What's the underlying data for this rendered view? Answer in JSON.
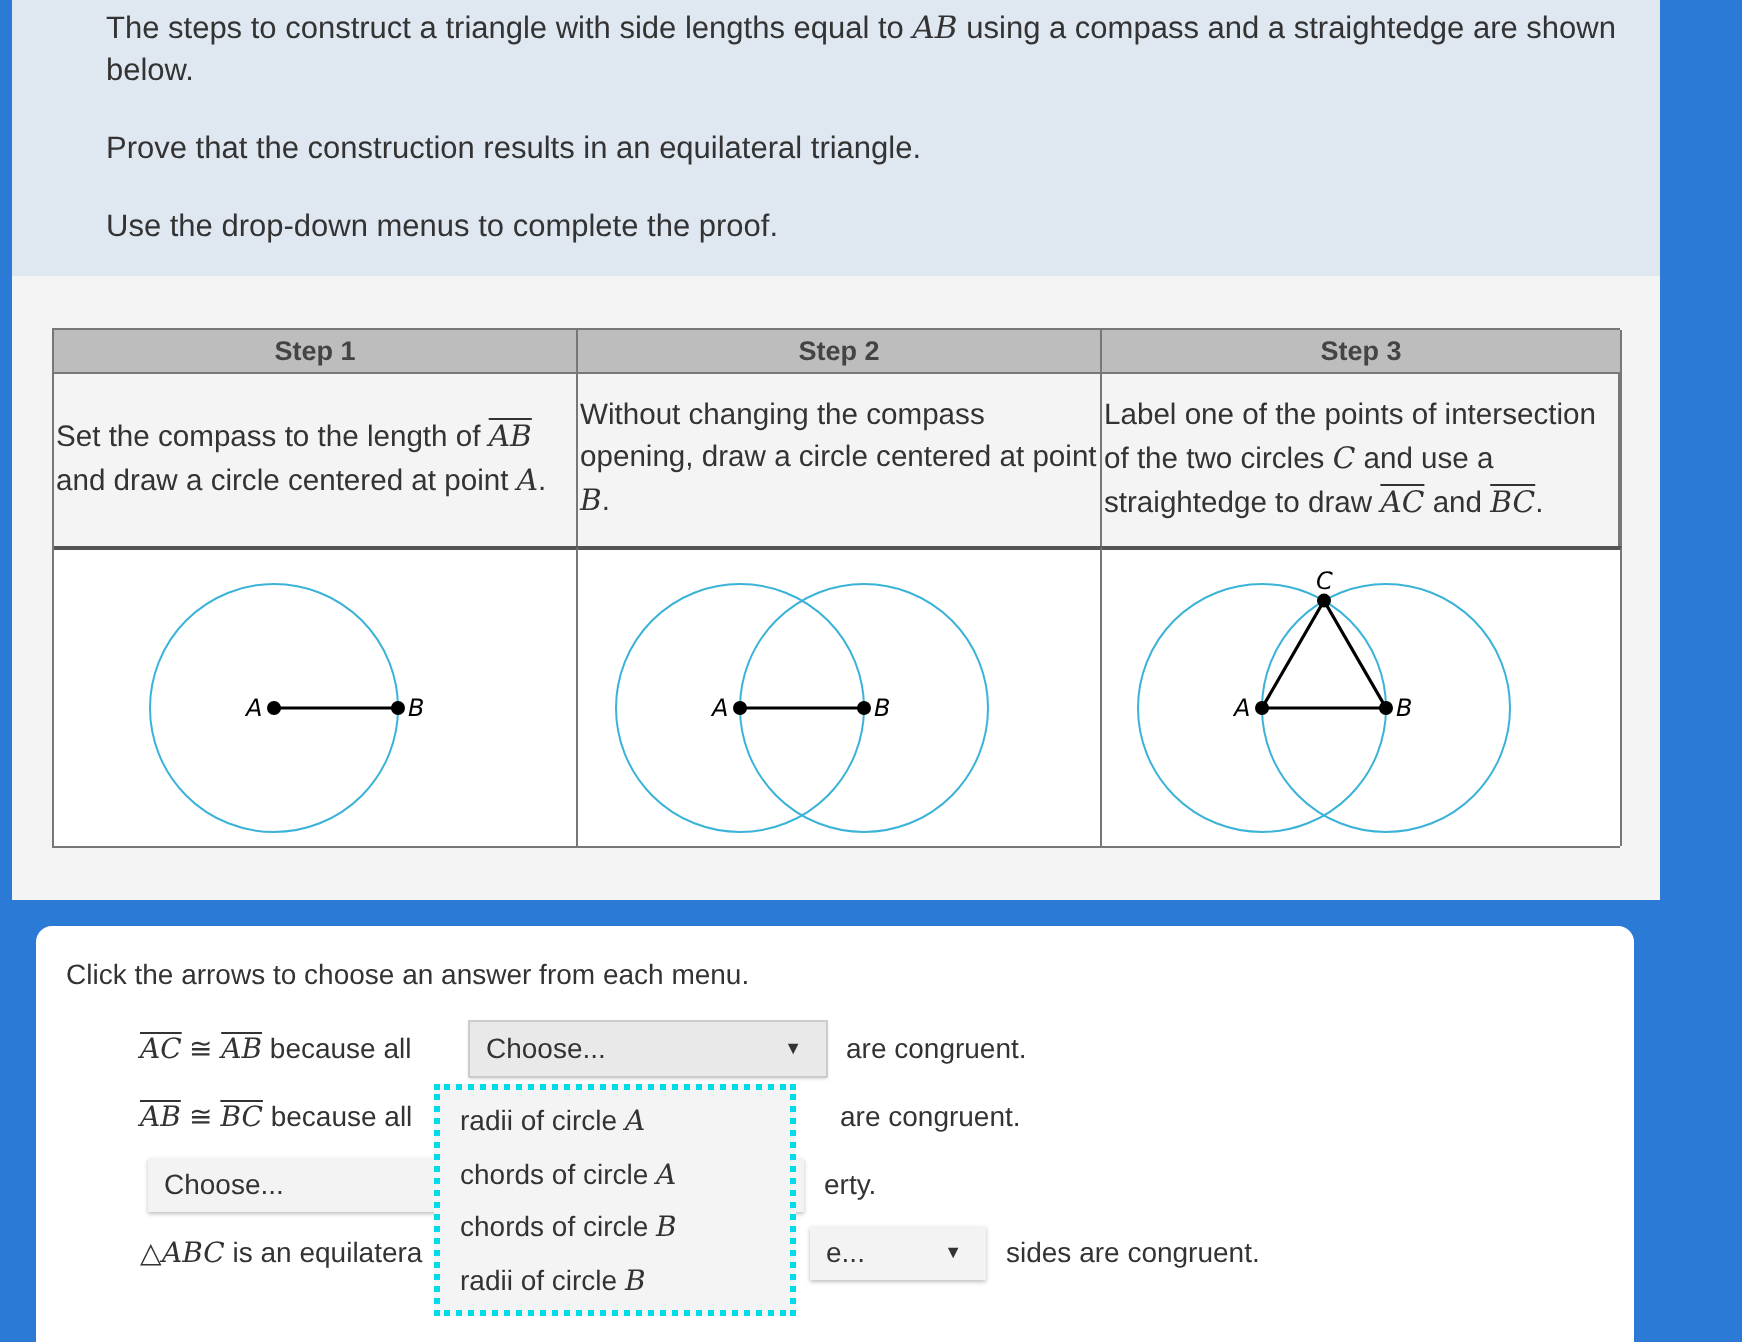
{
  "intro": [
    [
      {
        "kind": "text",
        "text": "The steps to construct a triangle with side lengths equal to "
      },
      {
        "kind": "var",
        "text": "AB"
      },
      {
        "kind": "text",
        "text": " using a compass and a straightedge are shown below."
      }
    ],
    [
      {
        "kind": "text",
        "text": "Prove that the construction results in an equilateral triangle."
      }
    ],
    [
      {
        "kind": "text",
        "text": "Use the drop-down menus to complete the proof."
      }
    ]
  ],
  "table": {
    "columns": [
      {
        "heading": "Step 1",
        "parts": [
          {
            "kind": "text",
            "text": "Set the compass to the length of "
          },
          {
            "kind": "seg",
            "text": "AB"
          },
          {
            "kind": "text",
            "text": "  and draw a circle centered at point "
          },
          {
            "kind": "var",
            "text": "A"
          },
          {
            "kind": "text",
            "text": "."
          }
        ]
      },
      {
        "heading": "Step 2",
        "parts": [
          {
            "kind": "text",
            "text": "Without changing the compass opening, draw a circle centered at point "
          },
          {
            "kind": "var",
            "text": "B"
          },
          {
            "kind": "text",
            "text": "."
          }
        ]
      },
      {
        "heading": "Step 3",
        "parts": [
          {
            "kind": "text",
            "text": "Label one of the points of intersection of the two circles "
          },
          {
            "kind": "var",
            "text": "C"
          },
          {
            "kind": "text",
            "text": " and use a straightedge to draw "
          },
          {
            "kind": "seg",
            "text": "AC"
          },
          {
            "kind": "text",
            "text": " and  "
          },
          {
            "kind": "seg",
            "text": "BC"
          },
          {
            "kind": "text",
            "text": "."
          }
        ]
      }
    ],
    "figures": [
      {
        "kind": "one_circle",
        "labels": [
          "A",
          "B"
        ]
      },
      {
        "kind": "two_circles",
        "labels": [
          "A",
          "B"
        ]
      },
      {
        "kind": "triangle",
        "labels": [
          "A",
          "B",
          "C"
        ]
      }
    ]
  },
  "proof": {
    "instruction": "Click the arrows to choose an answer from each menu.",
    "rows": [
      {
        "items": [
          {
            "kind": "phrase",
            "parts": [
              {
                "kind": "seg",
                "text": "AC"
              },
              {
                "kind": "text",
                "text": " ≅ "
              },
              {
                "kind": "seg",
                "text": "AB"
              },
              {
                "kind": "text",
                "text": " because all"
              }
            ]
          },
          {
            "kind": "select",
            "value": "Choose...",
            "open": true,
            "caret": "▼"
          },
          {
            "kind": "phrase",
            "parts": [
              {
                "kind": "text",
                "text": "are congruent."
              }
            ]
          }
        ]
      },
      {
        "items": [
          {
            "kind": "phrase",
            "parts": [
              {
                "kind": "seg",
                "text": "AB"
              },
              {
                "kind": "text",
                "text": " ≅ "
              },
              {
                "kind": "seg",
                "text": "BC"
              },
              {
                "kind": "text",
                "text": " because all"
              }
            ]
          },
          {
            "kind": "phrase",
            "parts": [
              {
                "kind": "text",
                "text": "are congruent."
              }
            ]
          }
        ]
      },
      {
        "items": [
          {
            "kind": "select",
            "value": "Choose..."
          },
          {
            "kind": "phrase",
            "parts": [
              {
                "kind": "text",
                "text": "erty."
              }
            ]
          }
        ]
      },
      {
        "items": [
          {
            "kind": "phrase",
            "parts": [
              {
                "kind": "text",
                "text": "△"
              },
              {
                "kind": "var",
                "text": "ABC"
              },
              {
                "kind": "text",
                "text": " is an equilatera"
              }
            ]
          },
          {
            "kind": "select",
            "value": "e...",
            "caret": "▼"
          },
          {
            "kind": "phrase",
            "parts": [
              {
                "kind": "text",
                "text": "sides are congruent."
              }
            ]
          }
        ]
      }
    ],
    "menu": {
      "options": [
        [
          {
            "kind": "text",
            "text": "radii of circle "
          },
          {
            "kind": "var",
            "text": "A"
          }
        ],
        [
          {
            "kind": "text",
            "text": "chords of circle "
          },
          {
            "kind": "var",
            "text": "A"
          }
        ],
        [
          {
            "kind": "text",
            "text": "chords of circle "
          },
          {
            "kind": "var",
            "text": "B"
          }
        ],
        [
          {
            "kind": "text",
            "text": "radii of circle "
          },
          {
            "kind": "var",
            "text": "B"
          }
        ]
      ]
    }
  }
}
